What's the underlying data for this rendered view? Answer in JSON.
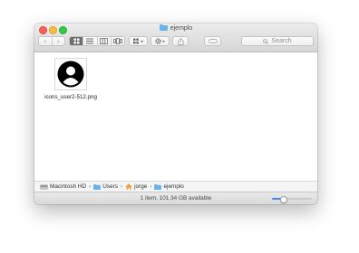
{
  "window": {
    "title": "ejemplo",
    "title_icon": "folder-icon"
  },
  "toolbar": {
    "back_glyph": "‹",
    "forward_glyph": "›",
    "view_modes": [
      "icon-view",
      "list-view",
      "column-view",
      "cover-flow-view"
    ],
    "active_view": "icon-view",
    "arrange_icon": "arrange-grid-icon",
    "action_icon": "gear-icon",
    "share_icon": "share-icon",
    "tags_icon": "tag-icon",
    "search_placeholder": "Search"
  },
  "files": [
    {
      "name": "icons_user2-512.png",
      "thumbnail": "user-avatar-icon"
    }
  ],
  "path": [
    {
      "label": "Macintosh HD",
      "icon": "hard-drive-icon"
    },
    {
      "label": "Users",
      "icon": "folder-icon"
    },
    {
      "label": "jorge",
      "icon": "home-icon"
    },
    {
      "label": "ejemplo",
      "icon": "folder-icon"
    }
  ],
  "path_separator": "›",
  "status": {
    "text": "1 item, 101.34 GB available",
    "zoom_level": 0.27
  },
  "colors": {
    "accent": "#3b8af5",
    "folder": "#69b3ec"
  }
}
